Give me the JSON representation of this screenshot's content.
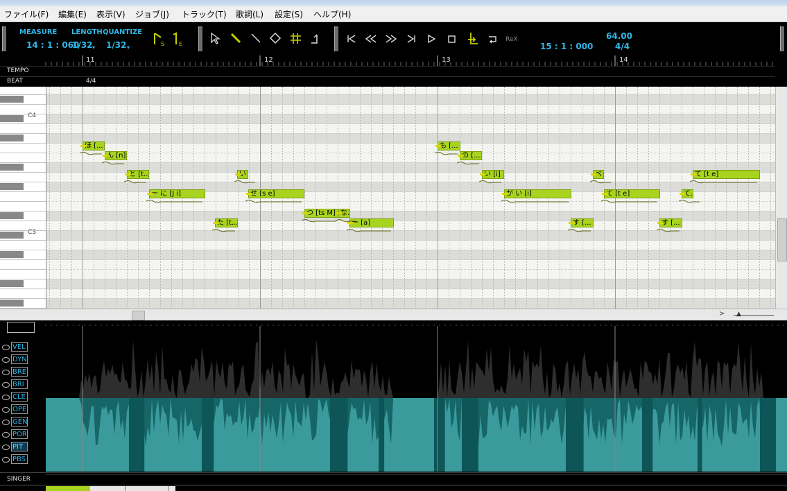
{
  "menu": [
    "ファイル(F)",
    "編集(E)",
    "表示(V)",
    "ジョブ(J)",
    "トラック(T)",
    "歌詞(L)",
    "設定(S)",
    "ヘルプ(H)"
  ],
  "toolbar": {
    "measure_label": "MEASURE",
    "measure_value": "14 : 1 : 060",
    "length_label": "LENGTH",
    "length_value": "1/32",
    "quantize_label": "QUANTIZE",
    "quantize_value": "1/32",
    "position_value": "15 : 1 : 000",
    "tempo_value": "64.00",
    "timesig_value": "4/4",
    "rex_label": "ReX"
  },
  "ruler": {
    "measures": [
      "11",
      "12",
      "13",
      "14"
    ],
    "tempo_label": "TEMPO",
    "beat_label": "BEAT",
    "beat_value": "4/4"
  },
  "keys": {
    "c4": "C4",
    "c3": "C3"
  },
  "notes": [
    {
      "lyric": "ほ [..."
    },
    {
      "lyric": "ん [n]"
    },
    {
      "lyric": "と [t..."
    },
    {
      "lyric": "ー に [J i]"
    },
    {
      "lyric": "た [t..."
    },
    {
      "lyric": "い"
    },
    {
      "lyric": "せ [s e]"
    },
    {
      "lyric": "つ [ts M]"
    },
    {
      "lyric": "な..."
    },
    {
      "lyric": "ー [a]"
    },
    {
      "lyric": "も [..."
    },
    {
      "lyric": "の [..."
    },
    {
      "lyric": "い [i]"
    },
    {
      "lyric": "が い [i]"
    },
    {
      "lyric": "す [..."
    },
    {
      "lyric": "べ"
    },
    {
      "lyric": "て [t e]"
    },
    {
      "lyric": "す [..."
    },
    {
      "lyric": "て..."
    },
    {
      "lyric": "て [t e]"
    }
  ],
  "controls": [
    "VEL",
    "DYN",
    "BRE",
    "BRI",
    "CLE",
    "OPE",
    "GEN",
    "POR",
    "PIT",
    "PBS"
  ],
  "active_control": "PIT",
  "singer_label": "SINGER",
  "colors": {
    "note": "#a8d420",
    "cyan": "#30b6e6",
    "graph": "#3a9a9c",
    "graph_dark": "#2e2e2e"
  }
}
